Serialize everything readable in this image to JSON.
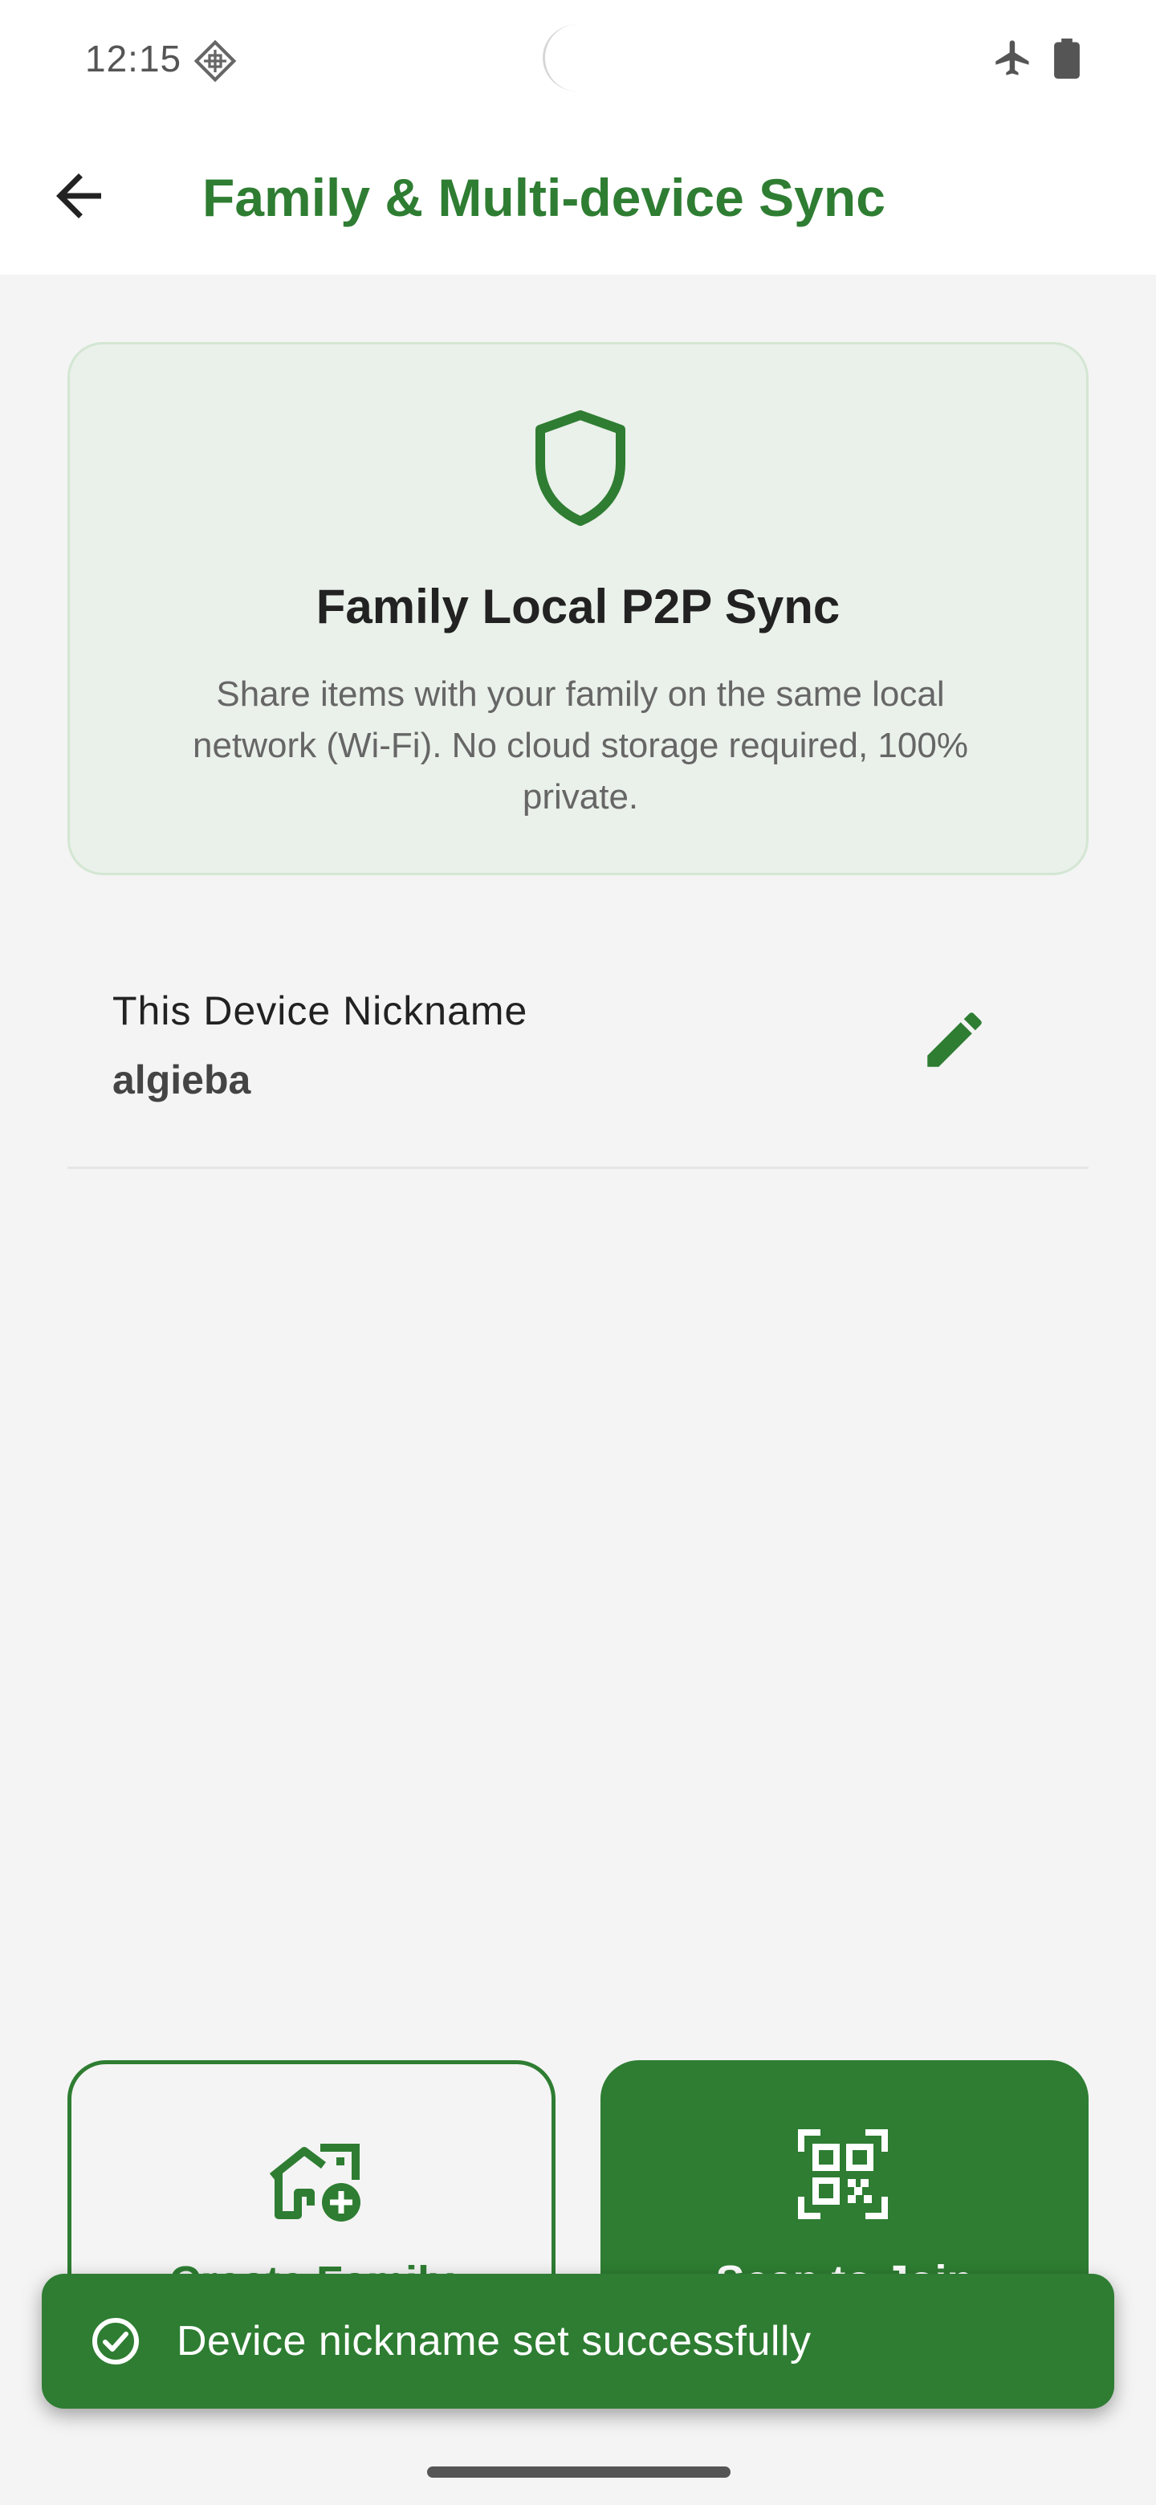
{
  "status_bar": {
    "time": "12:15",
    "icons": [
      "diamond-grid-icon",
      "airplane-icon",
      "battery-icon"
    ]
  },
  "app_bar": {
    "title": "Family & Multi-device Sync",
    "back_icon": "arrow-back-icon"
  },
  "info_card": {
    "icon": "shield-icon",
    "title": "Family Local P2P Sync",
    "description": "Share items with your family on the same local network (Wi-Fi). No cloud storage required, 100% private."
  },
  "device": {
    "label": "This Device Nickname",
    "nickname": "algieba",
    "edit_icon": "pencil-icon"
  },
  "actions": {
    "create_label": "Create Family",
    "create_icon": "home-add-icon",
    "scan_label": "Scan to Join",
    "scan_icon": "qr-code-scan-icon"
  },
  "snackbar": {
    "icon": "check-circle-icon",
    "message": "Device nickname set successfully"
  },
  "colors": {
    "accent": "#2e7d32",
    "card_background": "#eaf0ea",
    "page_background": "#f4f4f4"
  }
}
